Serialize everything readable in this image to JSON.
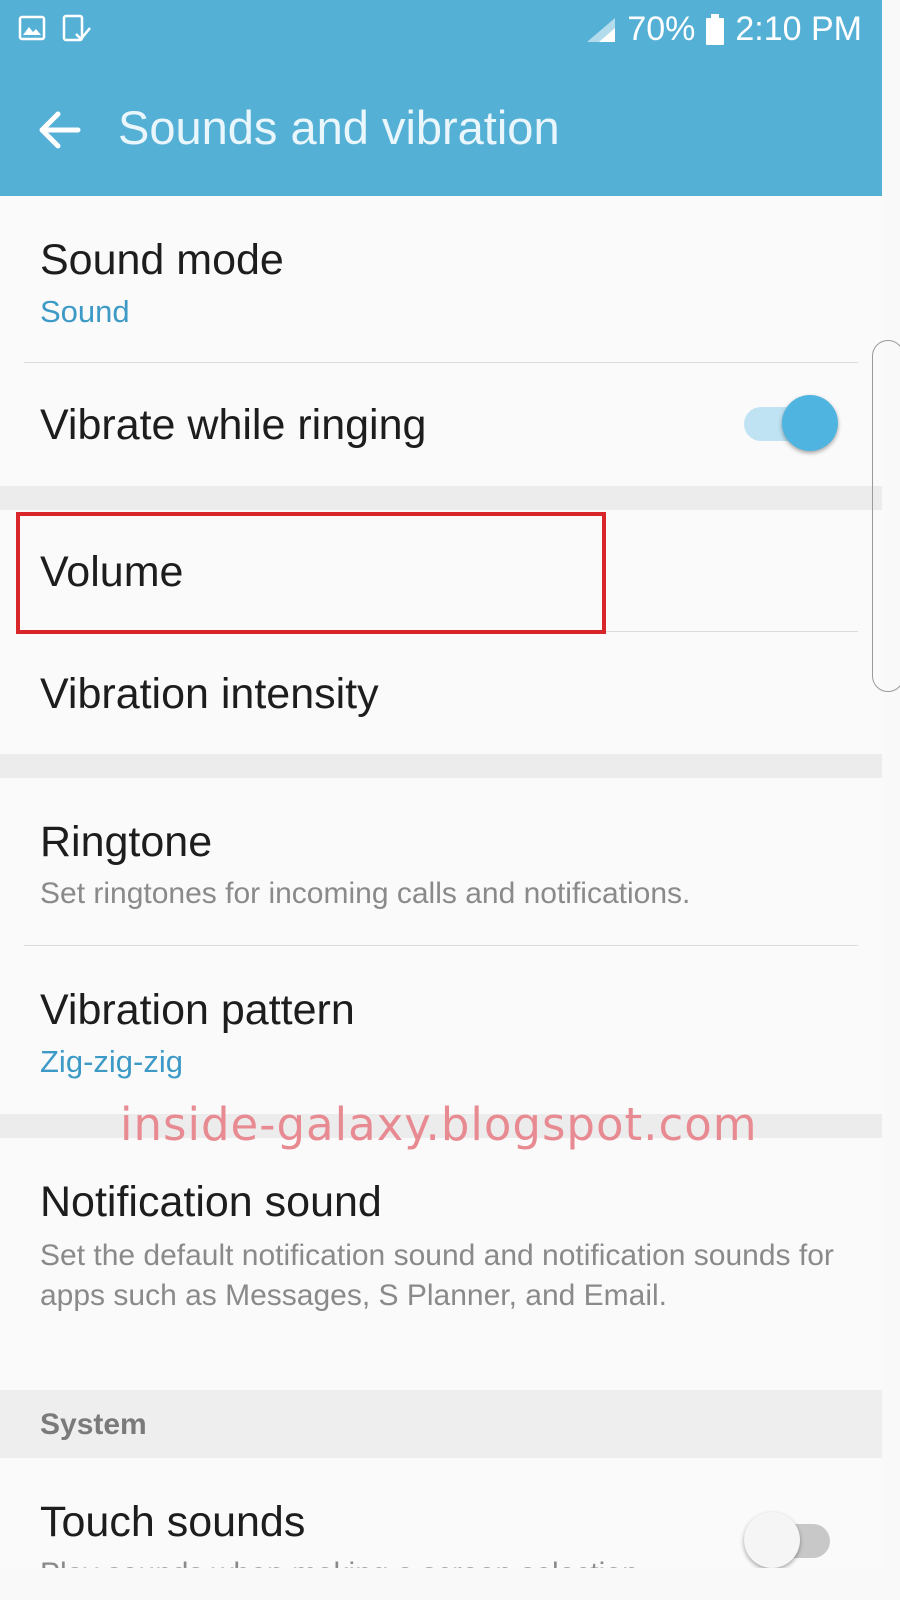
{
  "status_bar": {
    "battery": "70%",
    "time": "2:10 PM",
    "icons": [
      "gallery-icon",
      "download-done-icon",
      "signal-icon",
      "battery-icon"
    ]
  },
  "header": {
    "title": "Sounds and vibration",
    "background_color": "#55b0d6"
  },
  "settings": {
    "sound_mode": {
      "title": "Sound mode",
      "value": "Sound"
    },
    "vibrate_while_ringing": {
      "title": "Vibrate while ringing",
      "enabled": true
    },
    "volume": {
      "title": "Volume"
    },
    "vibration_intensity": {
      "title": "Vibration intensity"
    },
    "ringtone": {
      "title": "Ringtone",
      "summary": "Set ringtones for incoming calls and notifications."
    },
    "vibration_pattern": {
      "title": "Vibration pattern",
      "value": "Zig-zig-zig"
    },
    "notification_sound": {
      "title": "Notification sound",
      "summary": "Set the default notification sound and notification sounds for apps such as Messages, S Planner, and Email."
    },
    "system_category": "System",
    "touch_sounds": {
      "title": "Touch sounds",
      "summary": "Play sounds when making a screen selection.",
      "enabled": false
    }
  },
  "watermark": "inside-galaxy.blogspot.com",
  "colors": {
    "accent": "#3d9ac6",
    "highlight_box": "#d9262b",
    "toggle_on": "#4fb5e0",
    "toggle_off": "#f5f5f5"
  }
}
